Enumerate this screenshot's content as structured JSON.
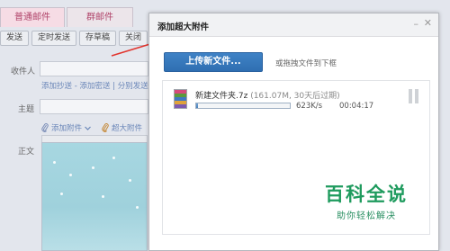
{
  "composer": {
    "tabs": [
      "普通邮件",
      "群邮件"
    ],
    "toolbar": [
      "发送",
      "定时发送",
      "存草稿",
      "关闭"
    ],
    "to_label": "收件人",
    "cc_links": "添加抄送 - 添加密送 | 分别发送",
    "subject_label": "主题",
    "add_attachment": "添加附件",
    "big_attachment": "超大附件",
    "body_label": "正文"
  },
  "dialog": {
    "title": "添加超大附件",
    "minimize_glyph": "–",
    "close_glyph": "✕",
    "upload_button": "上传新文件...",
    "drag_hint": "或拖拽文件到下框",
    "file": {
      "name": "新建文件夹.7z",
      "meta": "(161.07M, 30天后过期)",
      "progress": 0.02,
      "speed": "623K/s",
      "elapsed": "00:04:17"
    }
  },
  "watermark": {
    "main": "百科全说",
    "sub": "助你轻松解决"
  },
  "colors": {
    "upload_button": "#3475ba",
    "arrow": "#e2342d",
    "watermark": "#1f9b5e"
  },
  "icons": [
    "arrow-icon",
    "attachment-clip-icon",
    "chevron-down-icon",
    "archive-file-icon",
    "pause-icon",
    "minimize-icon",
    "close-icon"
  ]
}
